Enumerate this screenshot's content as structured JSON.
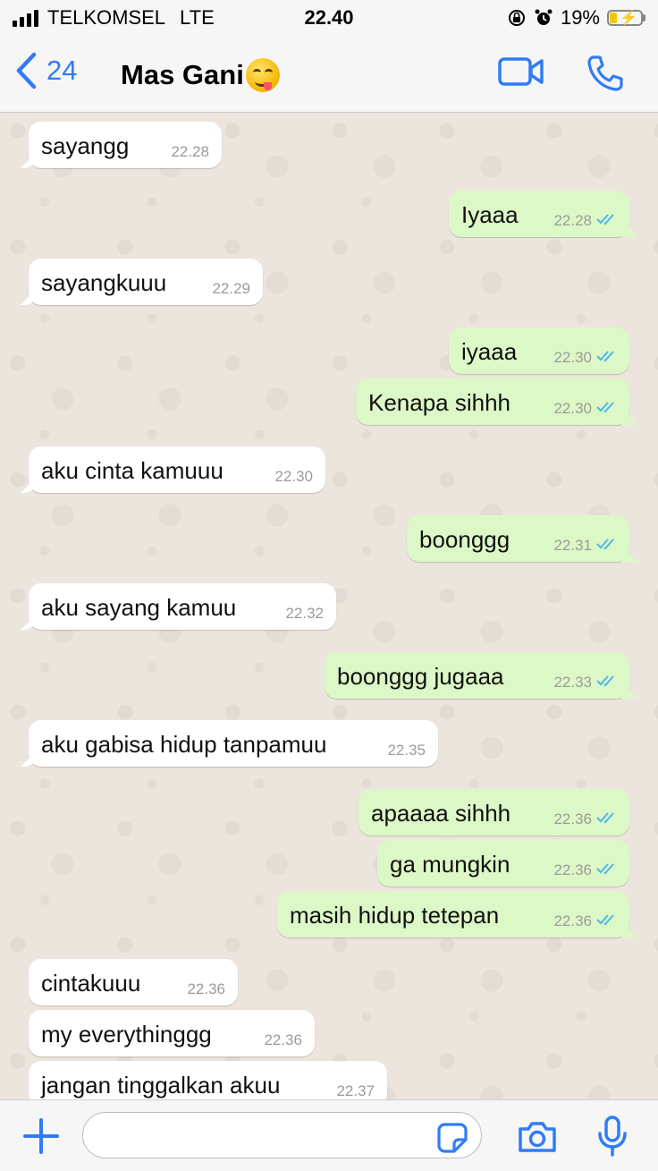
{
  "status_bar": {
    "carrier": "TELKOMSEL",
    "network": "LTE",
    "time": "22.40",
    "battery": "19%"
  },
  "header": {
    "back_count": "24",
    "contact_name": "Mas Gani",
    "contact_emoji": "face-savoring-food-emoji"
  },
  "messages": [
    {
      "dir": "in",
      "text": "sayangg",
      "time": "22.28"
    },
    {
      "dir": "out",
      "text": "Iyaaa",
      "time": "22.28",
      "status": "read"
    },
    {
      "dir": "in",
      "text": "sayangkuuu",
      "time": "22.29"
    },
    {
      "dir": "out",
      "text": "iyaaa",
      "time": "22.30",
      "status": "read"
    },
    {
      "dir": "out",
      "text": "Kenapa sihhh",
      "time": "22.30",
      "status": "read"
    },
    {
      "dir": "in",
      "text": "aku cinta kamuuu",
      "time": "22.30"
    },
    {
      "dir": "out",
      "text": "boonggg",
      "time": "22.31",
      "status": "read"
    },
    {
      "dir": "in",
      "text": "aku sayang kamuu",
      "time": "22.32"
    },
    {
      "dir": "out",
      "text": "boonggg jugaaa",
      "time": "22.33",
      "status": "read"
    },
    {
      "dir": "in",
      "text": "aku gabisa hidup tanpamuu",
      "time": "22.35"
    },
    {
      "dir": "out",
      "text": "apaaaa sihhh",
      "time": "22.36",
      "status": "read"
    },
    {
      "dir": "out",
      "text": "ga mungkin",
      "time": "22.36",
      "status": "read"
    },
    {
      "dir": "out",
      "text": "masih hidup tetepan",
      "time": "22.36",
      "status": "read"
    },
    {
      "dir": "in",
      "text": "cintakuuu",
      "time": "22.36"
    },
    {
      "dir": "in",
      "text": "my everythinggg",
      "time": "22.36"
    },
    {
      "dir": "in",
      "text": "jangan tinggalkan akuu",
      "time": "22.37"
    }
  ],
  "input": {
    "value": "",
    "placeholder": ""
  },
  "colors": {
    "accent": "#2f7cf6",
    "outgoing_bubble": "#dcf8c6",
    "incoming_bubble": "#ffffff",
    "read_ticks": "#4fb6ec",
    "chat_background": "#ece5dd"
  },
  "icons": [
    "chevron-left-icon",
    "video-camera-icon",
    "phone-icon",
    "plus-icon",
    "sticker-icon",
    "camera-icon",
    "microphone-icon",
    "double-check-icon"
  ]
}
